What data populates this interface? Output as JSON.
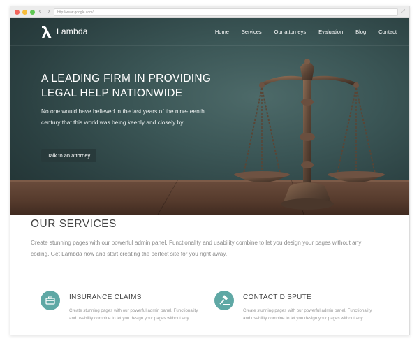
{
  "browser": {
    "url": "http://www.google.com/"
  },
  "header": {
    "logo_text": "Lambda",
    "menu": [
      {
        "label": "Home"
      },
      {
        "label": "Services"
      },
      {
        "label": "Our attorneys"
      },
      {
        "label": "Evaluation"
      },
      {
        "label": "Blog"
      },
      {
        "label": "Contact"
      }
    ]
  },
  "hero": {
    "title": "A leading firm in providing legal help nationwide",
    "subtitle": "No one would have believed in the last years of the nine-teenth century that this world was being keenly and closely by.",
    "cta_label": "Talk to an attorney"
  },
  "services": {
    "title": "Our services",
    "intro": "Create stunning pages with our powerful admin panel. Functionality and usability combine to let you design your pages without any coding. Get Lambda now and start creating the perfect site for you right away.",
    "items": [
      {
        "title": "Insurance claims",
        "text": "Create stunning pages with our powerful admin panel. Functionality and usability combine to let you design your pages without any",
        "icon": "briefcase-icon"
      },
      {
        "title": "Contact dispute",
        "text": "Create stunning pages with our powerful admin panel. Functionality and usability combine to let you design your pages without any",
        "icon": "gavel-icon"
      }
    ]
  },
  "colors": {
    "accent": "#5fa8a5",
    "hero_dark": "#2a3f40",
    "button": "#283a3b"
  }
}
